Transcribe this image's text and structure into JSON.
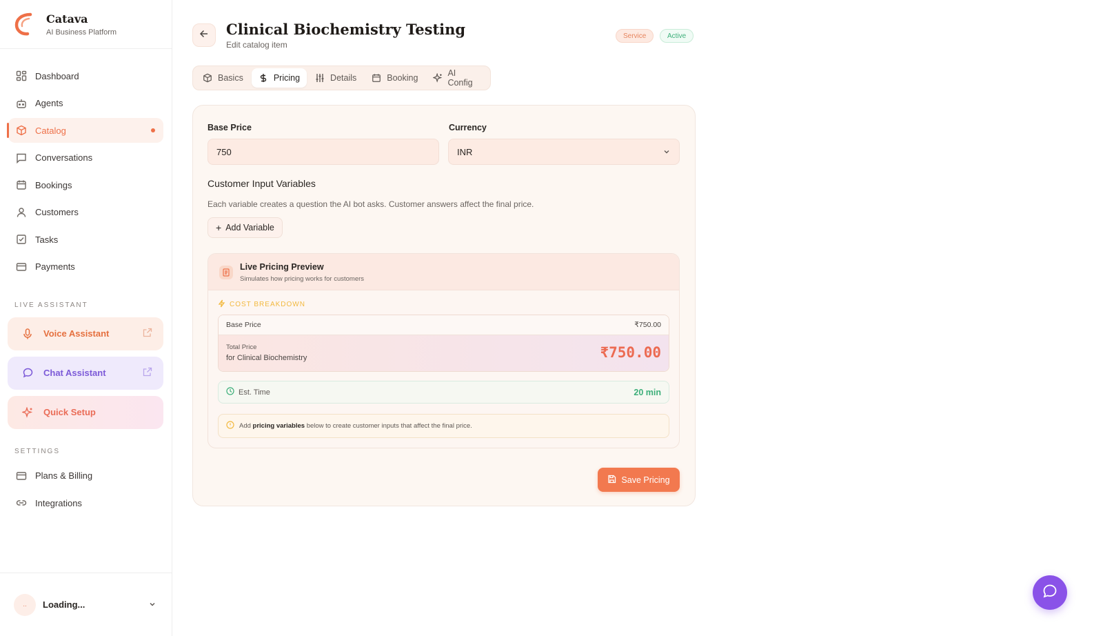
{
  "brand": {
    "name": "Catava",
    "tagline": "AI Business Platform",
    "accent": "#ee7048"
  },
  "sidebar": {
    "items": [
      {
        "label": "Dashboard",
        "icon": "dashboard-icon"
      },
      {
        "label": "Agents",
        "icon": "robot-icon"
      },
      {
        "label": "Catalog",
        "icon": "box-icon",
        "active": true
      },
      {
        "label": "Conversations",
        "icon": "message-icon"
      },
      {
        "label": "Bookings",
        "icon": "calendar-icon"
      },
      {
        "label": "Customers",
        "icon": "user-icon"
      },
      {
        "label": "Tasks",
        "icon": "checkbox-icon"
      },
      {
        "label": "Payments",
        "icon": "card-icon"
      }
    ],
    "live_assistant_label": "LIVE ASSISTANT",
    "assistants": [
      {
        "label": "Voice Assistant",
        "icon": "microphone-icon"
      },
      {
        "label": "Chat Assistant",
        "icon": "chat-bubble-icon"
      },
      {
        "label": "Quick Setup",
        "icon": "sparkle-icon"
      }
    ],
    "settings_label": "SETTINGS",
    "settings_items": [
      {
        "label": "Plans & Billing",
        "icon": "card-icon"
      },
      {
        "label": "Integrations",
        "icon": "link-icon"
      }
    ],
    "user": {
      "avatar_text": "..",
      "name": "Loading..."
    }
  },
  "header": {
    "title": "Clinical Biochemistry Testing",
    "subtitle": "Edit catalog item",
    "badges": {
      "type": "Service",
      "status": "Active"
    }
  },
  "tabs": [
    {
      "label": "Basics",
      "icon": "box-icon"
    },
    {
      "label": "Pricing",
      "icon": "dollar-icon",
      "active": true
    },
    {
      "label": "Details",
      "icon": "sliders-icon"
    },
    {
      "label": "Booking",
      "icon": "calendar-icon"
    },
    {
      "label": "AI Config",
      "icon": "sparkle-icon"
    }
  ],
  "pricing": {
    "base_price_label": "Base Price",
    "base_price_value": "750",
    "currency_label": "Currency",
    "currency_value": "INR",
    "variables_title": "Customer Input Variables",
    "variables_desc": "Each variable creates a question the AI bot asks. Customer answers affect the final price.",
    "add_variable_label": "Add Variable"
  },
  "preview": {
    "title": "Live Pricing Preview",
    "subtitle": "Simulates how pricing works for customers",
    "breakdown_label": "COST BREAKDOWN",
    "base_price_label": "Base Price",
    "base_price_value": "₹750.00",
    "total_label": "Total Price",
    "total_for": "for Clinical Biochemistry",
    "total_value": "₹750.00",
    "est_time_label": "Est. Time",
    "est_time_value": "20 min",
    "note_prefix": "Add",
    "note_bold": "pricing variables",
    "note_suffix": "below to create customer inputs that affect the final price."
  },
  "save_label": "Save Pricing"
}
